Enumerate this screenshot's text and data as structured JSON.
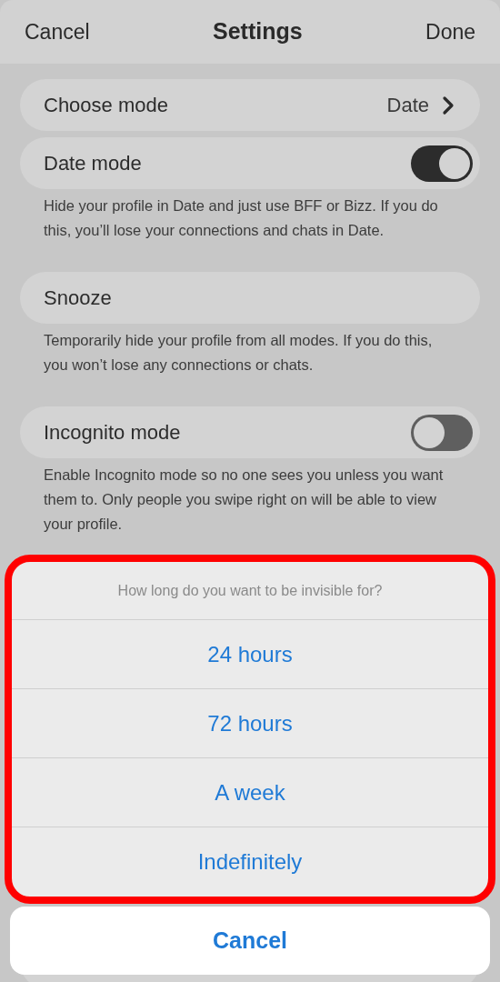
{
  "header": {
    "left": "Cancel",
    "title": "Settings",
    "right": "Done"
  },
  "sections": [
    {
      "kind": "link",
      "label": "Choose mode",
      "value": "Date"
    },
    {
      "kind": "toggle",
      "label": "Date mode",
      "on": true,
      "description": "Hide your profile in Date and just use BFF or Bizz. If you do this, you’ll lose your connections and chats in Date."
    },
    {
      "kind": "plain",
      "label": "Snooze",
      "description": "Temporarily hide your profile from all modes. If you do this, you won’t lose any connections or chats."
    },
    {
      "kind": "toggle",
      "label": "Incognito mode",
      "on": false,
      "description": "Enable Incognito mode so no one sees you unless you want them to. Only people you swipe right on will be able to view your profile."
    }
  ],
  "action_sheet": {
    "title": "How long do you want to be invisible for?",
    "options": [
      "24 hours",
      "72 hours",
      "A week",
      "Indefinitely"
    ],
    "cancel": "Cancel"
  }
}
